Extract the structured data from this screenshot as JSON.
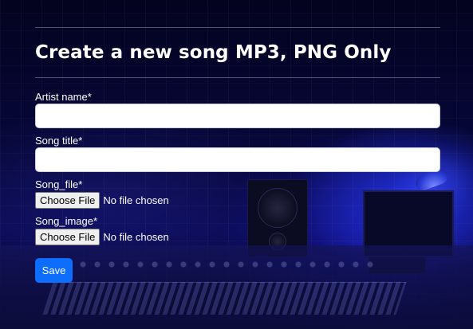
{
  "page": {
    "title": "Create a new song MP3, PNG Only"
  },
  "form": {
    "artist_name": {
      "label": "Artist name*",
      "value": "",
      "placeholder": ""
    },
    "song_title": {
      "label": "Song title*",
      "value": "",
      "placeholder": ""
    },
    "song_file": {
      "label": "Song_file*",
      "button_label": "Choose File",
      "status": "No file chosen"
    },
    "song_image": {
      "label": "Song_image*",
      "button_label": "Choose File",
      "status": "No file chosen"
    },
    "save_label": "Save"
  },
  "colors": {
    "primary_button": "#0d6efd",
    "background": "#05052a",
    "text": "#ffffff"
  }
}
